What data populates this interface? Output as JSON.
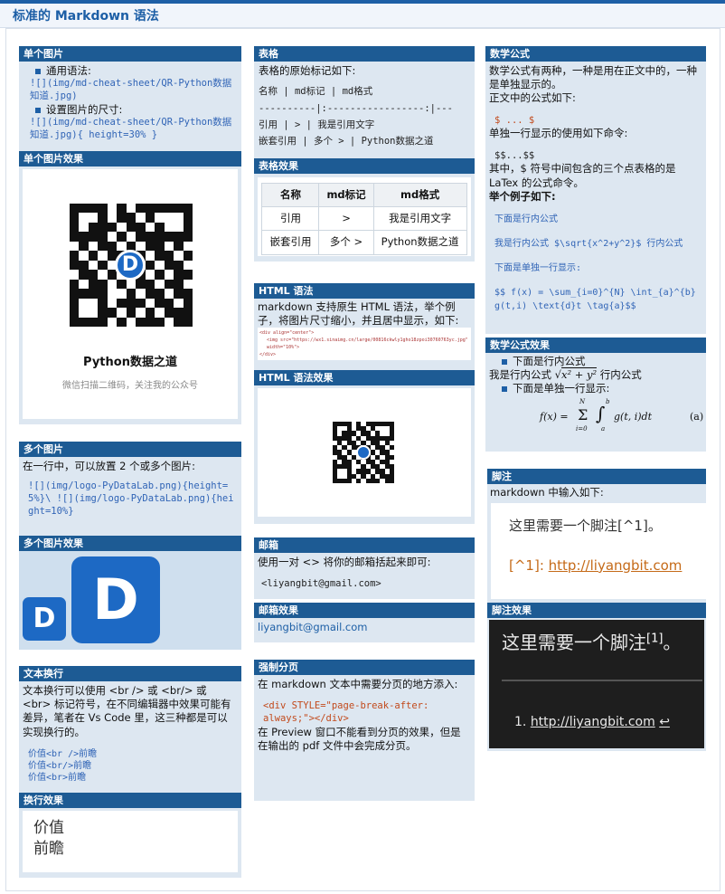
{
  "page_title": "标准的 Markdown 语法",
  "single_image": {
    "header": "单个图片",
    "bullet1": "通用语法:",
    "code1": "![](img/md-cheat-sheet/QR-Python数据知道.jpg)",
    "bullet2": "设置图片的尺寸:",
    "code2": "![](img/md-cheat-sheet/QR-Python数据知道.jpg){ height=30% }"
  },
  "single_image_effect": {
    "header": "单个图片效果",
    "name": "Python数据之道",
    "caption": "微信扫描二维码，关注我的公众号",
    "logo_letter": "D"
  },
  "multi_image": {
    "header": "多个图片",
    "desc": "在一行中，可以放置 2 个或多个图片:",
    "code": "![](img/logo-PyDataLab.png){height=5%}\\ ![](img/logo-PyDataLab.png){height=10%}"
  },
  "multi_image_effect": {
    "header": "多个图片效果",
    "logo_letter": "D"
  },
  "line_break": {
    "header": "文本换行",
    "desc": "文本换行可以使用 <br /> 或 <br/> 或 <br> 标记符号，在不同编辑器中效果可能有差异，笔者在 Vs Code 里，这三种都是可以实现换行的。",
    "lines": [
      "价值<br />前瞻",
      "价值<br/>前瞻",
      "价值<br>前瞻"
    ]
  },
  "line_break_effect": {
    "header": "换行效果",
    "line1": "价值",
    "line2": "前瞻"
  },
  "table": {
    "header": "表格",
    "desc": "表格的原始标记如下:",
    "lines": [
      "名称  | md标记  | md格式",
      "----------|:-----------------:|---",
      "引用  | >  | 我是引用文字",
      "嵌套引用  | 多个 >  |  Python数据之道"
    ]
  },
  "table_effect": {
    "header": "表格效果",
    "columns": [
      "名称",
      "md标记",
      "md格式"
    ],
    "rows": [
      [
        "引用",
        ">",
        "我是引用文字"
      ],
      [
        "嵌套引用",
        "多个 >",
        "Python数据之道"
      ]
    ]
  },
  "html": {
    "header": "HTML 语法",
    "desc": "markdown 支持原生 HTML 语法，举个例子，将图片尺寸缩小，并且居中显示，如下:",
    "code1": "<div align=\"center\">",
    "code2": "<img src=\"https://wx1.sinaimg.cn/large/00816ckwly1gho18zpoi30760763yc.jpg\" width=\"10%\">",
    "code3": "</div>"
  },
  "html_effect": {
    "header": "HTML 语法效果"
  },
  "email": {
    "header": "邮箱",
    "desc": "使用一对 <> 将你的邮箱括起来即可:",
    "code": "<liyangbit@gmail.com>"
  },
  "email_effect": {
    "header": "邮箱效果",
    "address": "liyangbit@gmail.com"
  },
  "pagebreak": {
    "header": "强制分页",
    "desc": "在 markdown 文本中需要分页的地方添入:",
    "code": "<div STYLE=\"page-break-after: always;\"></div>",
    "note": "在 Preview 窗口不能看到分页的效果，但是在输出的 pdf 文件中会完成分页。"
  },
  "math": {
    "header": "数学公式",
    "desc": "数学公式有两种，一种是用在正文中的，一种是单独显示的。",
    "inline_label": "正文中的公式如下:",
    "inline_code": "$ ... $",
    "block_label": "单独一行显示的使用如下命令:",
    "block_code": "$$...$$",
    "explain": "其中，$ 符号中间包含的三个点表格的是 LaTex 的公式命令。",
    "example": "举个例子如下:",
    "ex1": "下面是行内公式",
    "ex2": "我是行内公式 $\\sqrt{x^2+y^2}$ 行内公式",
    "ex3": "下面是单独一行显示:",
    "ex4": "$$ f(x) = \\sum_{i=0}^{N} \\int_{a}^{b} g(t,i) \\text{d}t \\tag{a}$$"
  },
  "math_effect": {
    "header": "数学公式效果",
    "line1": "下面是行内公式",
    "line2_pre": "我是行内公式",
    "line2_post": "行内公式",
    "line3": "下面是单独一行显示:",
    "tag": "(a)"
  },
  "footnote": {
    "header": "脚注",
    "desc": "markdown 中输入如下:",
    "line1": "这里需要一个脚注[^1]。",
    "ref": "[^1]:",
    "url": "http://liyangbit.com"
  },
  "footnote_effect": {
    "header": "脚注效果",
    "line_pre": "这里需要一个脚注",
    "sup": "[1]",
    "line_post": "。",
    "item": "1.",
    "url": "http://liyangbit.com",
    "back": "↩"
  }
}
